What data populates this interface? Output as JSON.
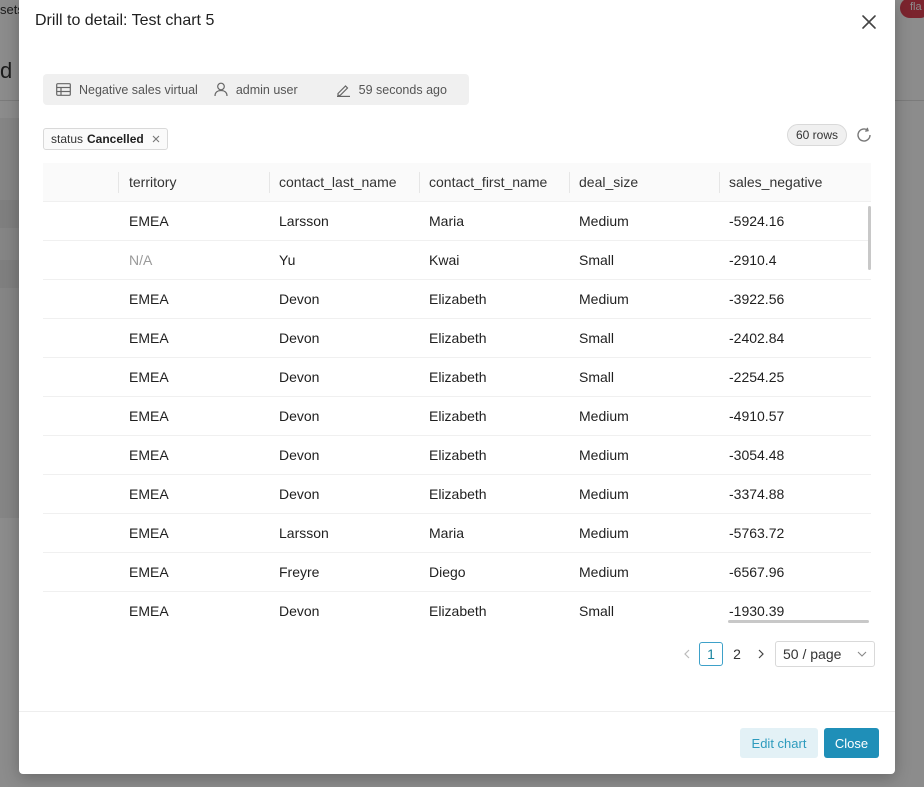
{
  "background": {
    "top_text": "sets",
    "big_text": "d",
    "badge": "fla"
  },
  "modal": {
    "title": "Drill to detail: Test chart 5",
    "meta": {
      "dataset": "Negative sales virtual",
      "owner": "admin user",
      "modified": "59 seconds ago"
    },
    "filter": {
      "key": "status",
      "value": "Cancelled"
    },
    "row_count": "60 rows"
  },
  "table": {
    "columns": [
      "territory",
      "contact_last_name",
      "contact_first_name",
      "deal_size",
      "sales_negative"
    ],
    "rows": [
      [
        "EMEA",
        "Larsson",
        "Maria",
        "Medium",
        "-5924.16"
      ],
      [
        "N/A",
        "Yu",
        "Kwai",
        "Small",
        "-2910.4"
      ],
      [
        "EMEA",
        "Devon",
        "Elizabeth",
        "Medium",
        "-3922.56"
      ],
      [
        "EMEA",
        "Devon",
        "Elizabeth",
        "Small",
        "-2402.84"
      ],
      [
        "EMEA",
        "Devon",
        "Elizabeth",
        "Small",
        "-2254.25"
      ],
      [
        "EMEA",
        "Devon",
        "Elizabeth",
        "Medium",
        "-4910.57"
      ],
      [
        "EMEA",
        "Devon",
        "Elizabeth",
        "Medium",
        "-3054.48"
      ],
      [
        "EMEA",
        "Devon",
        "Elizabeth",
        "Medium",
        "-3374.88"
      ],
      [
        "EMEA",
        "Larsson",
        "Maria",
        "Medium",
        "-5763.72"
      ],
      [
        "EMEA",
        "Freyre",
        "Diego",
        "Medium",
        "-6567.96"
      ],
      [
        "EMEA",
        "Devon",
        "Elizabeth",
        "Small",
        "-1930.39"
      ]
    ]
  },
  "pagination": {
    "pages": [
      "1",
      "2"
    ],
    "current": "1",
    "page_size": "50 / page"
  },
  "footer": {
    "edit_label": "Edit chart",
    "close_label": "Close"
  },
  "colors": {
    "primary": "#1f8fb8",
    "primary_light": "#e3f1f6",
    "badge_red": "#e04355"
  }
}
